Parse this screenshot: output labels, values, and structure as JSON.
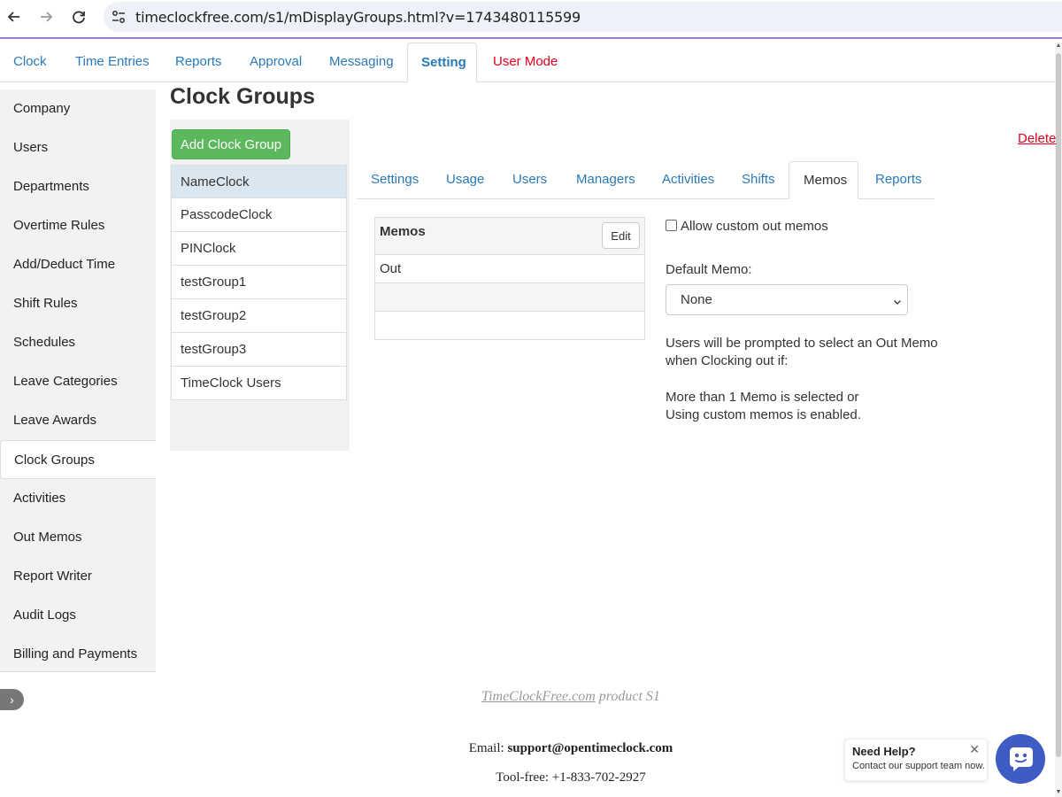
{
  "browser": {
    "url": "timeclockfree.com/s1/mDisplayGroups.html?v=1743480115599",
    "back_icon": "arrow-left-icon",
    "forward_icon": "arrow-right-icon",
    "reload_icon": "reload-icon",
    "site_info_icon": "tune-icon"
  },
  "top_tabs": [
    {
      "label": "Clock"
    },
    {
      "label": "Time Entries"
    },
    {
      "label": "Reports"
    },
    {
      "label": "Approval"
    },
    {
      "label": "Messaging"
    },
    {
      "label": "Setting"
    },
    {
      "label": "User Mode"
    }
  ],
  "sidebar": {
    "items": [
      {
        "label": "Company"
      },
      {
        "label": "Users"
      },
      {
        "label": "Departments"
      },
      {
        "label": "Overtime Rules"
      },
      {
        "label": "Add/Deduct Time"
      },
      {
        "label": "Shift Rules"
      },
      {
        "label": "Schedules"
      },
      {
        "label": "Leave Categories"
      },
      {
        "label": "Leave Awards"
      },
      {
        "label": "Clock Groups"
      },
      {
        "label": "Activities"
      },
      {
        "label": "Out Memos"
      },
      {
        "label": "Report Writer"
      },
      {
        "label": "Audit Logs"
      },
      {
        "label": "Billing and Payments"
      }
    ],
    "collapse_glyph": "›"
  },
  "main": {
    "title": "Clock Groups",
    "add_button": "Add Clock Group",
    "delete_link": "Delete",
    "groups": [
      {
        "label": "NameClock"
      },
      {
        "label": "PasscodeClock"
      },
      {
        "label": "PINClock"
      },
      {
        "label": "testGroup1"
      },
      {
        "label": "testGroup2"
      },
      {
        "label": "testGroup3"
      },
      {
        "label": "TimeClock Users"
      }
    ],
    "sub_tabs": [
      {
        "label": "Settings"
      },
      {
        "label": "Usage"
      },
      {
        "label": "Users"
      },
      {
        "label": "Managers"
      },
      {
        "label": "Activities"
      },
      {
        "label": "Shifts"
      },
      {
        "label": "Memos"
      },
      {
        "label": "Reports"
      }
    ],
    "memos": {
      "header": "Memos",
      "edit_button": "Edit",
      "rows": [
        "Out",
        "",
        ""
      ]
    },
    "allow_custom_label": "Allow custom out memos",
    "default_memo_label": "Default Memo:",
    "default_memo_value": "None",
    "info_line1": "Users will be prompted to select an Out Memo",
    "info_line2": "when Clocking out if:",
    "info_line3": "More than 1 Memo is selected or",
    "info_line4": "Using custom memos is enabled."
  },
  "footer": {
    "product_link": "TimeClockFree.com",
    "product_suffix": " product S1",
    "email_label": "Email: ",
    "email_value": "support@opentimeclock.com",
    "phone": "Tool-free: +1-833-702-2927"
  },
  "help": {
    "title": "Need Help?",
    "subtitle": "Contact our support team now.",
    "close_glyph": "✕"
  },
  "colors": {
    "link": "#2a7ab8",
    "danger": "#e0001a",
    "success": "#5cb85c",
    "chat": "#3f5bc4"
  }
}
